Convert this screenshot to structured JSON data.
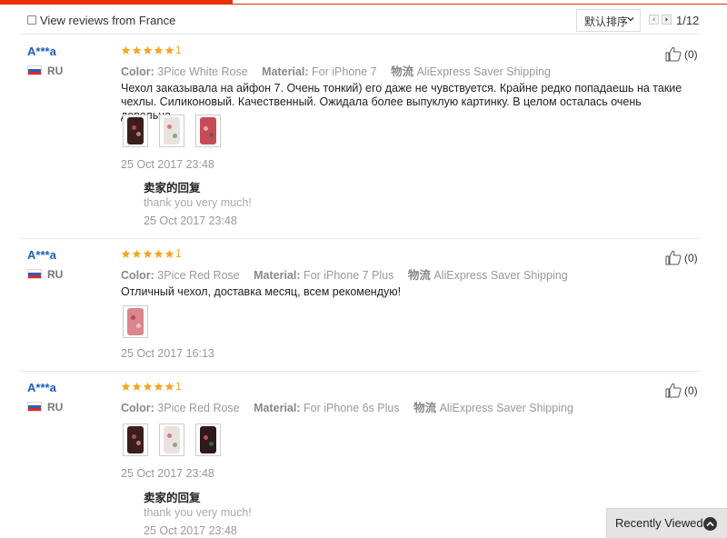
{
  "filter": {
    "label": "View reviews from France",
    "checked": false
  },
  "sort": {
    "selected": "默认排序"
  },
  "pager": {
    "count": "1/12"
  },
  "accent_color": "#e62e04",
  "star_color": "#f6a623",
  "reviews": [
    {
      "user": "A***a",
      "country": "RU",
      "stars": 5,
      "stars_tail": "1",
      "props": [
        {
          "key": "Color:",
          "value": "3Pice White Rose"
        },
        {
          "key": "Material:",
          "value": "For iPhone 7"
        },
        {
          "key": "物流",
          "value": "AliExpress Saver Shipping"
        }
      ],
      "text": "Чехол заказывала на айфон 7. Очень тонкий) его даже не чувствуется. Крайне редко попадаешь на такие чехлы. Силиконовый. Качественный. Ожидала более выпуклую картинку. В целом осталась очень довольна.",
      "photos": 3,
      "date": "25 Oct 2017 23:48",
      "reply": {
        "title": "卖家的回复",
        "text": "thank you very much!",
        "date": "25 Oct 2017 23:48"
      },
      "helpful": "(0)"
    },
    {
      "user": "A***a",
      "country": "RU",
      "stars": 5,
      "stars_tail": "1",
      "props": [
        {
          "key": "Color:",
          "value": "3Pice Red Rose"
        },
        {
          "key": "Material:",
          "value": "For iPhone 7 Plus"
        },
        {
          "key": "物流",
          "value": "AliExpress Saver Shipping"
        }
      ],
      "text": "Отличный чехол, доставка месяц, всем рекомендую!",
      "photos": 1,
      "date": "25 Oct 2017 16:13",
      "helpful": "(0)"
    },
    {
      "user": "A***a",
      "country": "RU",
      "stars": 5,
      "stars_tail": "1",
      "props": [
        {
          "key": "Color:",
          "value": "3Pice Red Rose"
        },
        {
          "key": "Material:",
          "value": "For iPhone 6s Plus"
        },
        {
          "key": "物流",
          "value": "AliExpress Saver Shipping"
        }
      ],
      "text": "",
      "photos": 3,
      "date": "25 Oct 2017 23:48",
      "reply": {
        "title": "卖家的回复",
        "text": "thank you very much!",
        "date": "25 Oct 2017 23:48"
      },
      "helpful": "(0)"
    }
  ],
  "recently_viewed": {
    "label": "Recently Viewed",
    "icon": "chevron-up-icon"
  }
}
